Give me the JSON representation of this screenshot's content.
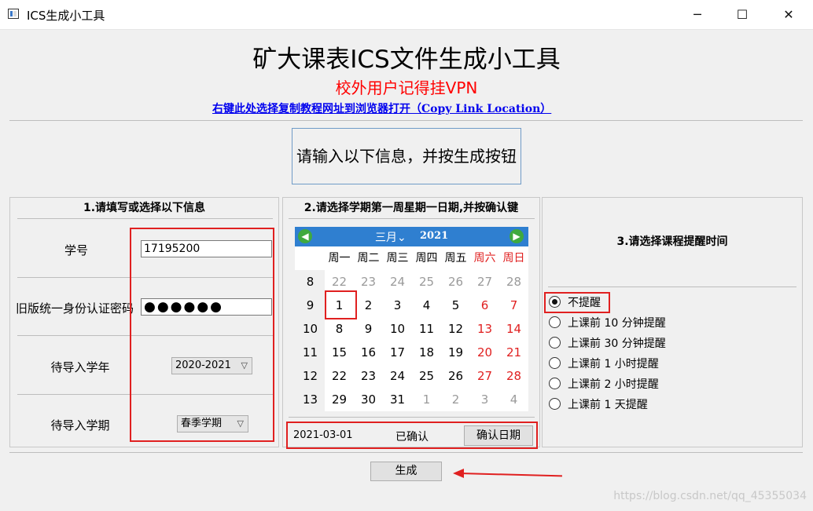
{
  "window": {
    "title": "ICS生成小工具",
    "minimize": "─",
    "maximize": "☐",
    "close": "✕"
  },
  "header": {
    "title": "矿大课表ICS文件生成小工具",
    "vpn_note": "校外用户记得挂VPN",
    "tutorial_link": "右键此处选择复制教程网址到浏览器打开（Copy Link Location）"
  },
  "instruction": "请输入以下信息，并按生成按钮",
  "section1": {
    "title": "1.请填写或选择以下信息",
    "student_id_label": "学号",
    "student_id_value": "17195200",
    "password_label": "旧版统一身份认证密码",
    "password_value": "●●●●●●",
    "year_label": "待导入学年",
    "year_value": "2020-2021",
    "term_label": "待导入学期",
    "term_value": "春季学期"
  },
  "section2": {
    "title": "2.请选择学期第一周星期一日期,并按确认键",
    "calendar": {
      "prev_icon": "◀",
      "next_icon": "▶",
      "month": "三月",
      "month_dropdown_icon": "⌄",
      "year": "2021",
      "weekdays": [
        "周一",
        "周二",
        "周三",
        "周四",
        "周五",
        "周六",
        "周日"
      ],
      "weeks": [
        {
          "num": "8",
          "days": [
            "22",
            "23",
            "24",
            "25",
            "26",
            "27",
            "28"
          ]
        },
        {
          "num": "9",
          "days": [
            "1",
            "2",
            "3",
            "4",
            "5",
            "6",
            "7"
          ]
        },
        {
          "num": "10",
          "days": [
            "8",
            "9",
            "10",
            "11",
            "12",
            "13",
            "14"
          ]
        },
        {
          "num": "11",
          "days": [
            "15",
            "16",
            "17",
            "18",
            "19",
            "20",
            "21"
          ]
        },
        {
          "num": "12",
          "days": [
            "22",
            "23",
            "24",
            "25",
            "26",
            "27",
            "28"
          ]
        },
        {
          "num": "13",
          "days": [
            "29",
            "30",
            "31",
            "1",
            "2",
            "3",
            "4"
          ]
        }
      ],
      "selected": "1"
    },
    "selected_date": "2021-03-01",
    "status": "已确认",
    "confirm_button": "确认日期"
  },
  "section3": {
    "title": "3.请选择课程提醒时间",
    "options": [
      "不提醒",
      "上课前 10 分钟提醒",
      "上课前 30 分钟提醒",
      "上课前 1 小时提醒",
      "上课前 2 小时提醒",
      "上课前 1 天提醒"
    ],
    "selected_index": 0
  },
  "generate_button": "生成",
  "watermark": "https://blog.csdn.net/qq_45355034",
  "colors": {
    "accent_red": "#e02020",
    "calendar_header": "#2f7fd0",
    "nav_green": "#3fa93f",
    "link_blue": "#0000ee"
  }
}
